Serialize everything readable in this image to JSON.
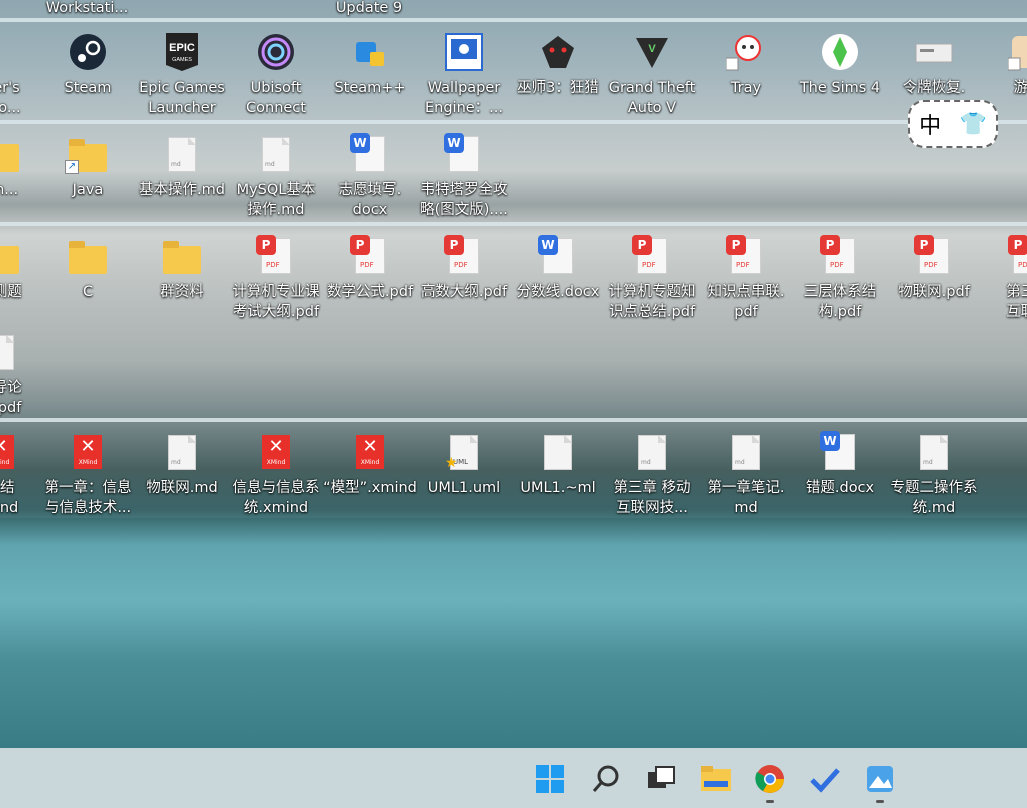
{
  "top_row_partial": [
    "Workstati...",
    "Update 9"
  ],
  "row1": [
    {
      "label": "eier's\nntio...",
      "icon": "game-icon"
    },
    {
      "label": "Steam",
      "icon": "steam-icon"
    },
    {
      "label": "Epic Games\nLauncher",
      "icon": "epic-games-icon"
    },
    {
      "label": "Ubisoft\nConnect",
      "icon": "ubisoft-icon"
    },
    {
      "label": "Steam++",
      "icon": "steam-plus-plus-icon"
    },
    {
      "label": "Wallpaper\nEngine：...",
      "icon": "wallpaper-engine-icon"
    },
    {
      "label": "巫师3：狂猎",
      "icon": "witcher-icon"
    },
    {
      "label": "Grand Theft\nAuto V",
      "icon": "gta-icon"
    },
    {
      "label": "Tray",
      "icon": "tray-icon"
    },
    {
      "label": "The Sims 4",
      "icon": "sims-icon"
    },
    {
      "label": "令牌恢复.",
      "icon": "token-icon"
    },
    {
      "label": "游戏",
      "icon": "game-shortcut-icon"
    }
  ],
  "row2": [
    {
      "label": "qin...",
      "icon": "folder-icon"
    },
    {
      "label": "Java",
      "icon": "folder-icon"
    },
    {
      "label": "基本操作.md",
      "icon": "md-file-icon"
    },
    {
      "label": "MySQL基本\n操作.md",
      "icon": "md-file-icon"
    },
    {
      "label": "志愿填写.\ndocx",
      "icon": "docx-icon"
    },
    {
      "label": "韦特塔罗全攻\n略(图文版)....",
      "icon": "docx-icon"
    }
  ],
  "row3": [
    {
      "label": "自测题",
      "icon": "folder-icon"
    },
    {
      "label": "C",
      "icon": "folder-icon"
    },
    {
      "label": "群资料",
      "icon": "folder-icon"
    },
    {
      "label": "计算机专业课\n考试大纲.pdf",
      "icon": "pdf-icon"
    },
    {
      "label": "数学公式.pdf",
      "icon": "pdf-icon"
    },
    {
      "label": "高数大纲.pdf",
      "icon": "pdf-icon"
    },
    {
      "label": "分数线.docx",
      "icon": "docx-icon"
    },
    {
      "label": "计算机专题知\n识点总结.pdf",
      "icon": "pdf-icon"
    },
    {
      "label": "知识点串联.\npdf",
      "icon": "pdf-icon"
    },
    {
      "label": "三层体系结\n构.pdf",
      "icon": "pdf-icon"
    },
    {
      "label": "物联网.pdf",
      "icon": "pdf-icon"
    },
    {
      "label": "第三章\n互联网",
      "icon": "pdf-icon"
    }
  ],
  "row3b": {
    "label": "术导论\n题.pdf",
    "icon": "pdf-icon"
  },
  "row4": [
    {
      "label": "系结\nmind",
      "icon": "xmind-icon"
    },
    {
      "label": "第一章：信息\n与信息技术...",
      "icon": "xmind-icon"
    },
    {
      "label": "物联网.md",
      "icon": "md-file-icon"
    },
    {
      "label": "信息与信息系\n统.xmind",
      "icon": "xmind-icon"
    },
    {
      "label": "“模型”.xmind",
      "icon": "xmind-icon"
    },
    {
      "label": "UML1.uml",
      "icon": "uml-icon"
    },
    {
      "label": "UML1.~ml",
      "icon": "blank-file-icon"
    },
    {
      "label": "第三章 移动\n互联网技...",
      "icon": "md-file-icon"
    },
    {
      "label": "第一章笔记.\nmd",
      "icon": "md-file-icon"
    },
    {
      "label": "错题.docx",
      "icon": "docx-icon"
    },
    {
      "label": "专题二操作系\n统.md",
      "icon": "md-file-icon"
    }
  ],
  "ime": {
    "mode": "中",
    "skin": "shirt-icon"
  },
  "taskbar": [
    "windows-start-icon",
    "search-icon",
    "task-view-icon",
    "file-explorer-icon",
    "chrome-icon",
    "todo-icon",
    "photos-icon"
  ],
  "colors": {
    "pdf": "#e53935",
    "docx": "#2f6fe0",
    "xmind": "#e8302b",
    "folder": "#f6c84b",
    "taskbar": "#c9d6da"
  }
}
